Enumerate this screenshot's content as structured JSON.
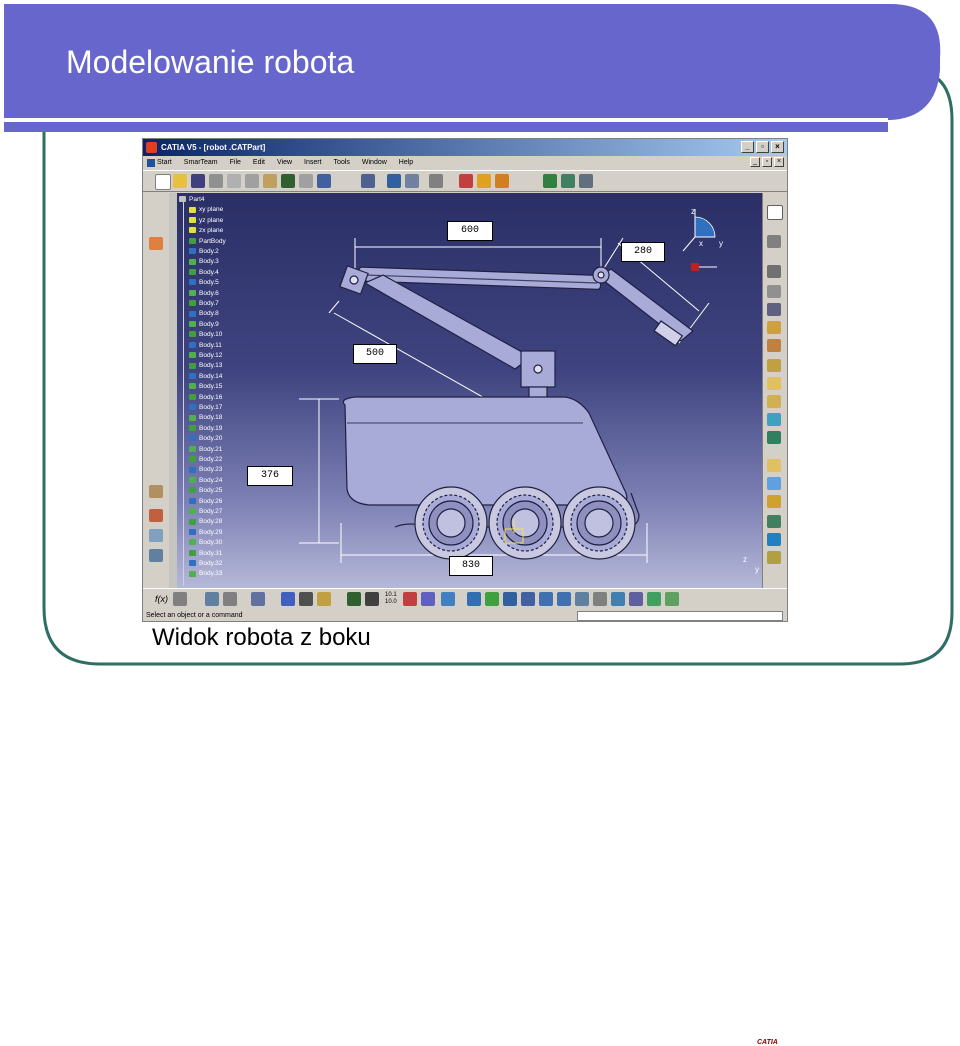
{
  "slide": {
    "title": "Modelowanie robota",
    "caption": "Widok robota z boku"
  },
  "window": {
    "title": "CATIA V5 - [robot .CATPart]",
    "min_label": "_",
    "max_label": "▫",
    "close_label": "×",
    "menu": [
      "Start",
      "SmarTeam",
      "File",
      "Edit",
      "View",
      "Insert",
      "Tools",
      "Window",
      "Help"
    ]
  },
  "tree": {
    "root": "Part4",
    "items": [
      "xy plane",
      "yz plane",
      "zx plane",
      "PartBody",
      "Body.2",
      "Body.3",
      "Body.4",
      "Body.5",
      "Body.6",
      "Body.7",
      "Body.8",
      "Body.9",
      "Body.10",
      "Body.11",
      "Body.12",
      "Body.13",
      "Body.14",
      "Body.15",
      "Body.16",
      "Body.17",
      "Body.18",
      "Body.19",
      "Body.20",
      "Body.21",
      "Body.22",
      "Body.23",
      "Body.24",
      "Body.25",
      "Body.26",
      "Body.27",
      "Body.28",
      "Body.29",
      "Body.30",
      "Body.31",
      "Body.32",
      "Body.33"
    ]
  },
  "dimensions": {
    "upper_arm": "600",
    "forearm": "280",
    "lower_arm": "500",
    "body_height": "376",
    "body_length": "830"
  },
  "compass": {
    "z": "z",
    "x": "x",
    "y": "y"
  },
  "status": {
    "message": "Select an object or a command"
  },
  "toolbar": {
    "formula_label": "f(x)",
    "scale_top": "10.1",
    "scale_bottom": "10.0"
  },
  "colors": {
    "slide_header": "#6666cc",
    "slide_frame": "#2e7d6e",
    "viewport_top": "#2b2f66",
    "viewport_bottom": "#b6b8d8",
    "robot_fill": "#a8aad8"
  }
}
